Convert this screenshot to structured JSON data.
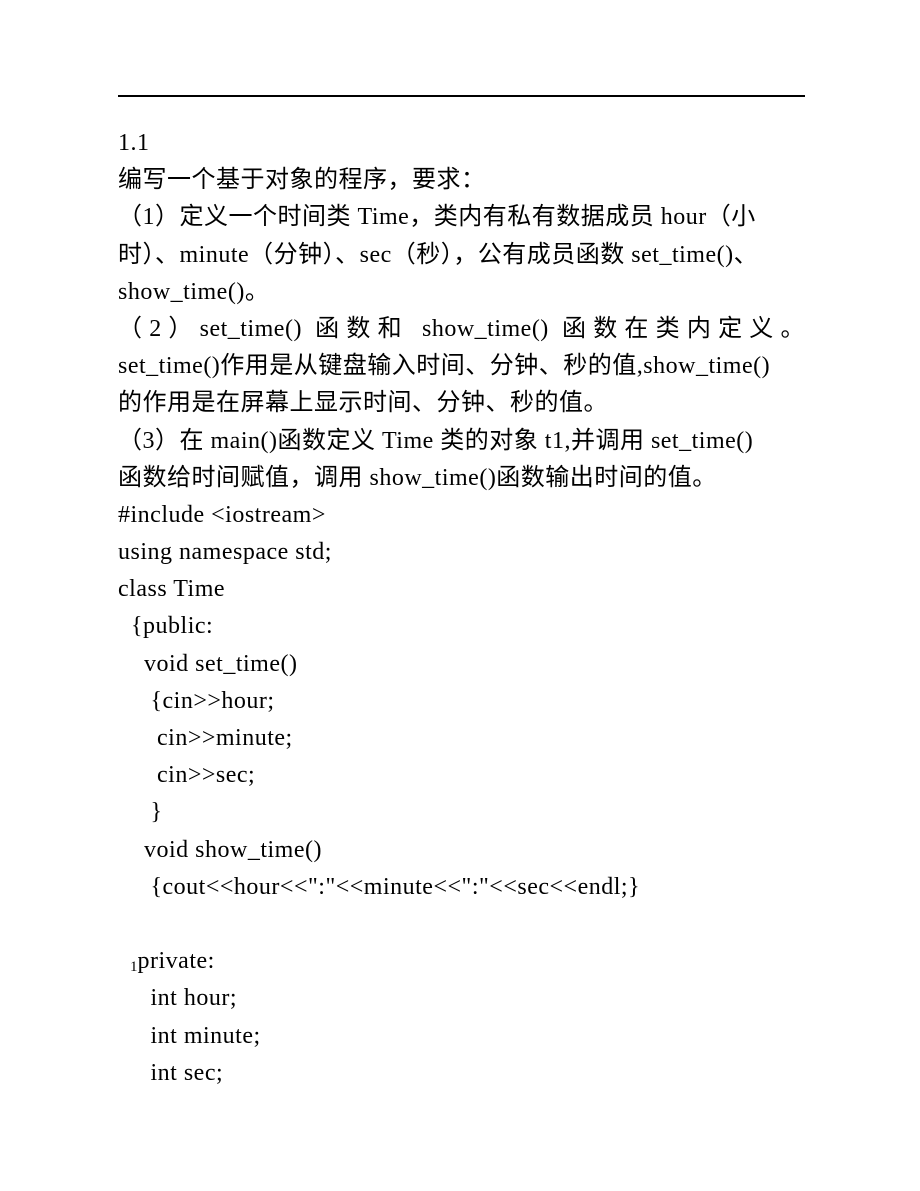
{
  "lines": [
    {
      "text": "1.1",
      "justify": false
    },
    {
      "text": "编写一个基于对象的程序，要求：",
      "justify": false
    },
    {
      "text": "（1）定义一个时间类 Time，类内有私有数据成员 hour（小",
      "justify": false
    },
    {
      "text": "时）、minute（分钟）、sec（秒），公有成员函数 set_time()、",
      "justify": false
    },
    {
      "text": "show_time()。",
      "justify": false
    },
    {
      "text": "（2）set_time() 函数和 show_time() 函数在类内定义。",
      "justify": true
    },
    {
      "text": "set_time()作用是从键盘输入时间、分钟、秒的值,show_time()",
      "justify": false
    },
    {
      "text": "的作用是在屏幕上显示时间、分钟、秒的值。",
      "justify": false
    },
    {
      "text": "（3）在 main()函数定义 Time 类的对象 t1,并调用 set_time()",
      "justify": false
    },
    {
      "text": "函数给时间赋值，调用 show_time()函数输出时间的值。",
      "justify": false
    },
    {
      "text": "#include <iostream>",
      "justify": false
    },
    {
      "text": "using namespace std;",
      "justify": false
    },
    {
      "text": "class Time",
      "justify": false
    },
    {
      "text": "  {public:",
      "justify": false
    },
    {
      "text": "    void set_time()",
      "justify": false
    },
    {
      "text": "     {cin>>hour;",
      "justify": false
    },
    {
      "text": "      cin>>minute;",
      "justify": false
    },
    {
      "text": "      cin>>sec;",
      "justify": false
    },
    {
      "text": "     }",
      "justify": false
    },
    {
      "text": "    void show_time()",
      "justify": false
    },
    {
      "text": "     {cout<<hour<<\":\"<<minute<<\":\"<<sec<<endl;}",
      "justify": false
    },
    {
      "text": "",
      "justify": false
    },
    {
      "text": "   private:",
      "justify": false
    },
    {
      "text": "     int hour;",
      "justify": false
    },
    {
      "text": "     int minute;",
      "justify": false
    },
    {
      "text": "     int sec;",
      "justify": false
    }
  ],
  "pageNumber": "1"
}
